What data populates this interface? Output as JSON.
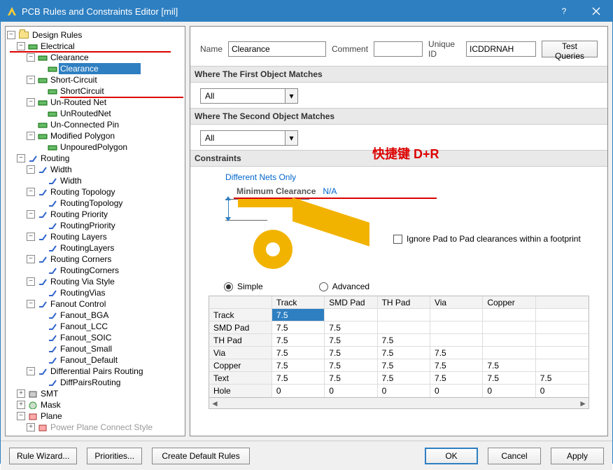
{
  "window": {
    "title": "PCB Rules and Constraints Editor [mil]"
  },
  "tree": {
    "root": "Design Rules",
    "electrical": "Electrical",
    "clearance_group": "Clearance",
    "clearance_rule": "Clearance",
    "short_group": "Short-Circuit",
    "short_rule": "ShortCircuit",
    "unrouted_group": "Un-Routed Net",
    "unrouted_rule": "UnRoutedNet",
    "unconnected": "Un-Connected Pin",
    "modpoly_group": "Modified Polygon",
    "modpoly_rule": "UnpouredPolygon",
    "routing": "Routing",
    "width_group": "Width",
    "width_rule": "Width",
    "rtopo_group": "Routing Topology",
    "rtopo_rule": "RoutingTopology",
    "rprio_group": "Routing Priority",
    "rprio_rule": "RoutingPriority",
    "rlayers_group": "Routing Layers",
    "rlayers_rule": "RoutingLayers",
    "rcorners_group": "Routing Corners",
    "rcorners_rule": "RoutingCorners",
    "rvia_group": "Routing Via Style",
    "rvia_rule": "RoutingVias",
    "fanout_group": "Fanout Control",
    "fanout_bga": "Fanout_BGA",
    "fanout_lcc": "Fanout_LCC",
    "fanout_soic": "Fanout_SOIC",
    "fanout_small": "Fanout_Small",
    "fanout_default": "Fanout_Default",
    "diffpair_group": "Differential Pairs Routing",
    "diffpair_rule": "DiffPairsRouting",
    "smt": "SMT",
    "mask": "Mask",
    "plane": "Plane",
    "ppcs": "Power Plane Connect Style"
  },
  "form": {
    "name_lbl": "Name",
    "name_val": "Clearance",
    "comment_lbl": "Comment",
    "comment_val": "",
    "uid_lbl": "Unique ID",
    "uid_val": "ICDDRNAH",
    "test_queries": "Test Queries"
  },
  "sections": {
    "first": "Where The First Object Matches",
    "second": "Where The Second Object Matches",
    "constraints": "Constraints"
  },
  "scope": {
    "all1": "All",
    "all2": "All"
  },
  "annotation": "快捷键 D+R",
  "diagram": {
    "nets_only": "Different Nets Only",
    "min_clear_lbl": "Minimum Clearance",
    "min_clear_val": "N/A",
    "ignore_pad": "Ignore Pad to Pad clearances within a footprint"
  },
  "mode": {
    "simple": "Simple",
    "advanced": "Advanced"
  },
  "grid": {
    "headers": [
      "Track",
      "SMD Pad",
      "TH Pad",
      "Via",
      "Copper",
      ""
    ],
    "rows": [
      {
        "name": "Track",
        "cells": [
          "7.5",
          "",
          "",
          "",
          "",
          ""
        ]
      },
      {
        "name": "SMD Pad",
        "cells": [
          "7.5",
          "7.5",
          "",
          "",
          "",
          ""
        ]
      },
      {
        "name": "TH Pad",
        "cells": [
          "7.5",
          "7.5",
          "7.5",
          "",
          "",
          ""
        ]
      },
      {
        "name": "Via",
        "cells": [
          "7.5",
          "7.5",
          "7.5",
          "7.5",
          "",
          ""
        ]
      },
      {
        "name": "Copper",
        "cells": [
          "7.5",
          "7.5",
          "7.5",
          "7.5",
          "7.5",
          ""
        ]
      },
      {
        "name": "Text",
        "cells": [
          "7.5",
          "7.5",
          "7.5",
          "7.5",
          "7.5",
          "7.5"
        ]
      },
      {
        "name": "Hole",
        "cells": [
          "0",
          "0",
          "0",
          "0",
          "0",
          "0"
        ]
      }
    ]
  },
  "buttons": {
    "rule_wizard": "Rule Wizard...",
    "priorities": "Priorities...",
    "create_default": "Create Default Rules",
    "ok": "OK",
    "cancel": "Cancel",
    "apply": "Apply"
  }
}
